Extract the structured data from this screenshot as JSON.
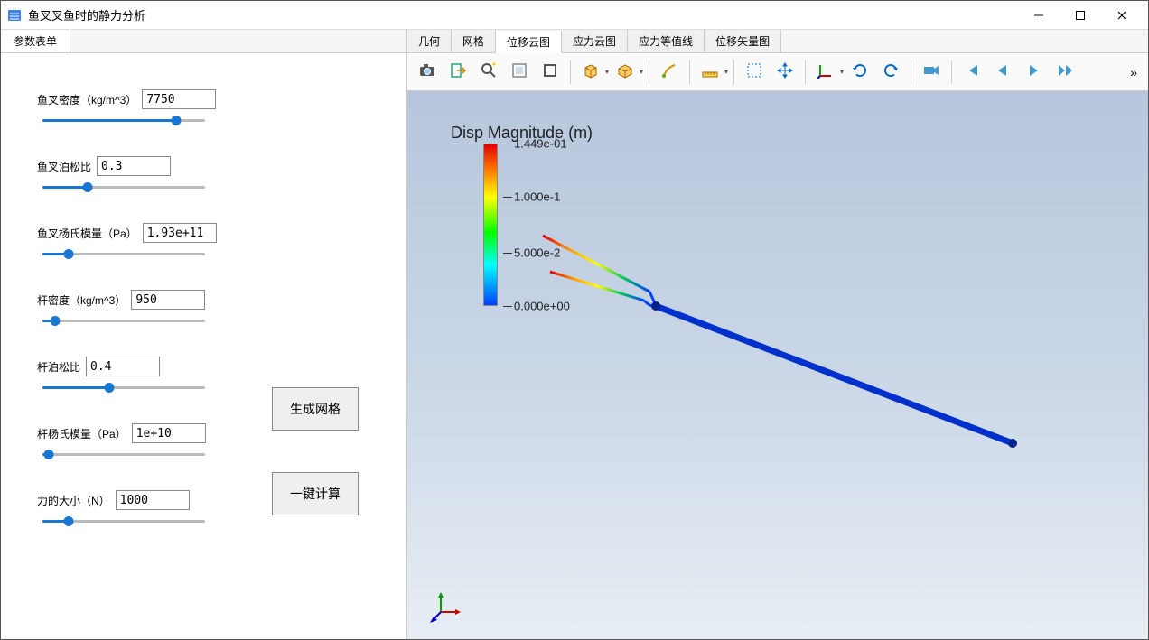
{
  "window": {
    "title": "鱼叉叉鱼时的静力分析"
  },
  "sidebar": {
    "tab_label": "参数表单",
    "params": [
      {
        "label": "鱼叉密度（kg/m^3）",
        "value": "7750",
        "pos": 82
      },
      {
        "label": "鱼叉泊松比",
        "value": "0.3",
        "pos": 28
      },
      {
        "label": "鱼叉杨氏模量（Pa）",
        "value": "1.93e+11",
        "pos": 16
      },
      {
        "label": "杆密度（kg/m^3）",
        "value": "950",
        "pos": 8
      },
      {
        "label": "杆泊松比",
        "value": "0.4",
        "pos": 41
      },
      {
        "label": "杆杨氏模量（Pa）",
        "value": "1e+10",
        "pos": 4
      },
      {
        "label": "力的大小（N）",
        "value": "1000",
        "pos": 16
      }
    ],
    "buttons": {
      "generate_mesh": "生成网格",
      "one_click_calc": "一键计算"
    }
  },
  "main_tabs": [
    {
      "label": "几何",
      "active": false
    },
    {
      "label": "网格",
      "active": false
    },
    {
      "label": "位移云图",
      "active": true
    },
    {
      "label": "应力云图",
      "active": false
    },
    {
      "label": "应力等值线",
      "active": false
    },
    {
      "label": "位移矢量图",
      "active": false
    }
  ],
  "toolbar_icons": [
    "camera-icon",
    "export-icon",
    "zoom-icon",
    "bounding-box-icon",
    "outline-icon",
    "box-front-icon",
    "box-persp-icon",
    "brush-icon",
    "ruler-icon",
    "select-icon",
    "move-icon",
    "axes-icon",
    "rotate-cw-icon",
    "rotate-ccw-icon",
    "camera-view-icon",
    "skip-start-icon",
    "step-back-icon",
    "play-icon",
    "step-forward-icon"
  ],
  "legend": {
    "title": "Disp Magnitude (m)",
    "ticks": [
      {
        "label": "1.449e-01",
        "t": 0.0
      },
      {
        "label": "1.000e-1",
        "t": 0.33
      },
      {
        "label": "5.000e-2",
        "t": 0.67
      },
      {
        "label": "0.000e+00",
        "t": 1.0
      }
    ]
  }
}
